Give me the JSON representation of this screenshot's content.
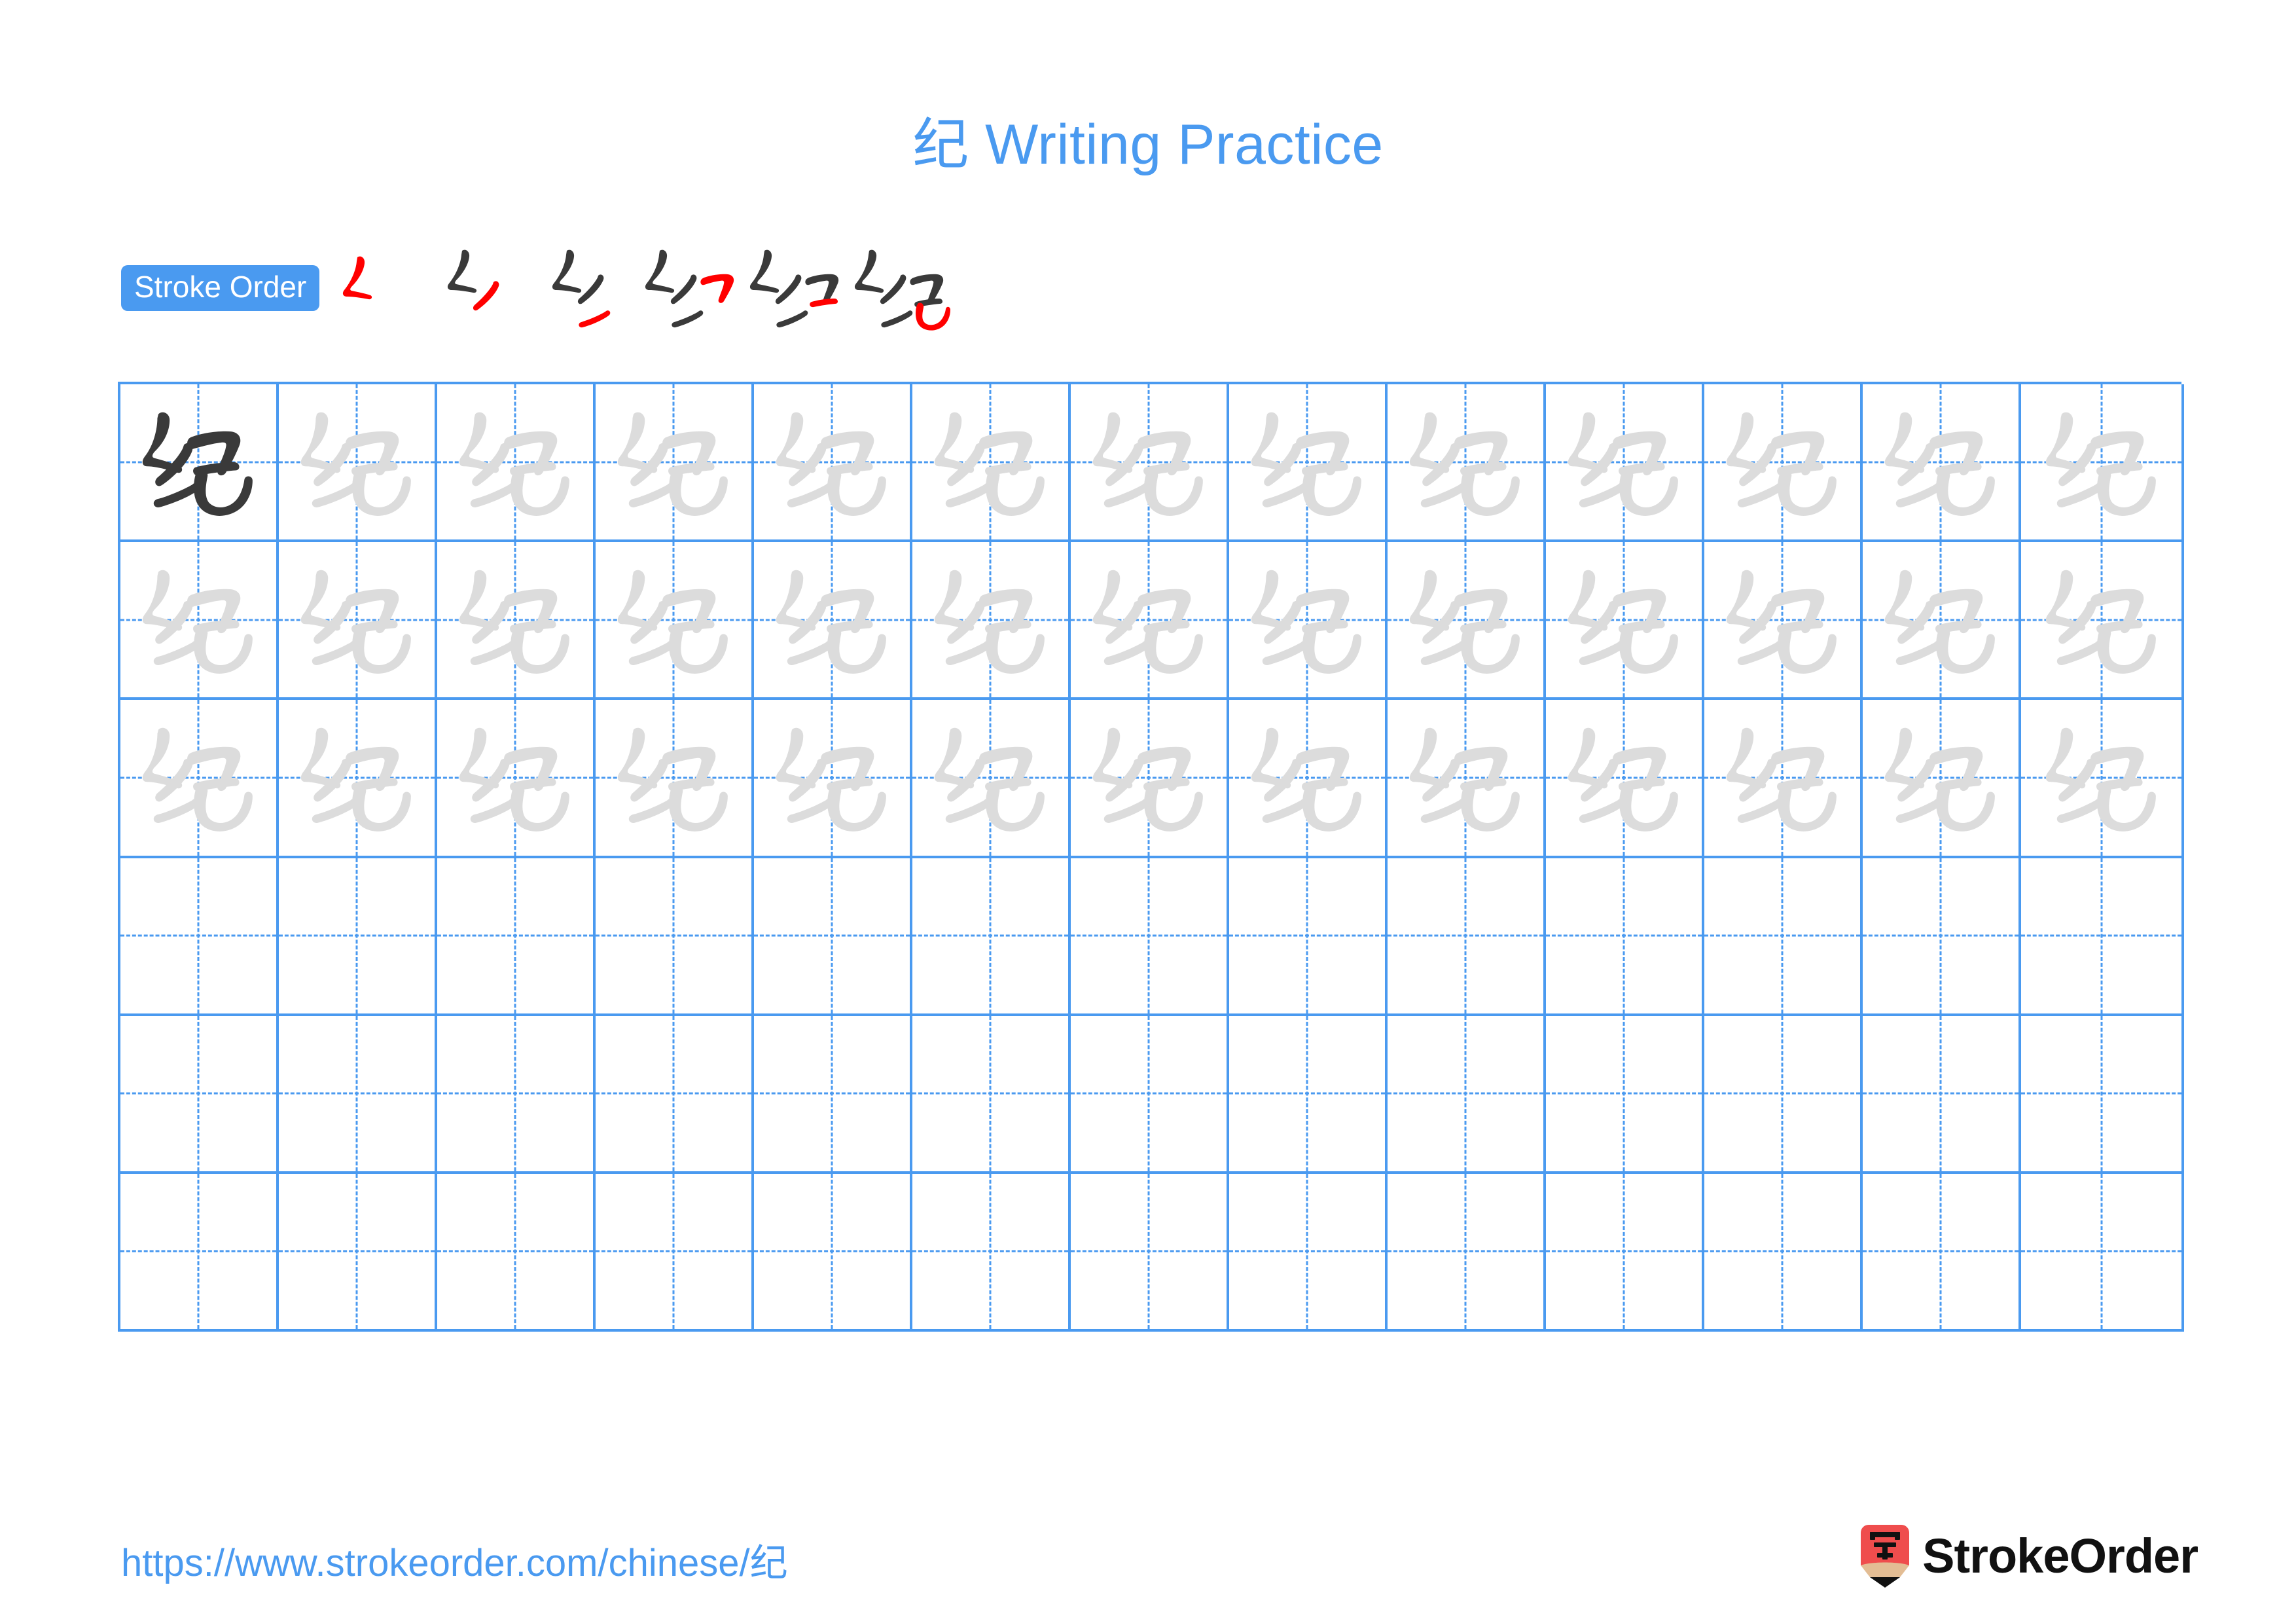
{
  "character": "纪",
  "page_title": "纪 Writing Practice",
  "title_prefix_char": "纪",
  "title_suffix": " Writing Practice",
  "colors": {
    "accent_blue": "#4a9af0",
    "grid_line_blue": "#4a9af0",
    "new_stroke_red": "#ff0000",
    "prior_stroke_dark": "#3a3a3a",
    "ghost_char_gray": "#dcdcdc",
    "logo_red": "#ef4d4d",
    "logo_wood": "#e3bd94",
    "logo_text_black": "#111111"
  },
  "stroke_order": {
    "badge_label": "Stroke Order",
    "total_strokes": 6,
    "steps": [
      {
        "index": 1,
        "label": "stroke-1",
        "strokes_shown": 1
      },
      {
        "index": 2,
        "label": "stroke-2",
        "strokes_shown": 2
      },
      {
        "index": 3,
        "label": "stroke-3",
        "strokes_shown": 3
      },
      {
        "index": 4,
        "label": "stroke-4",
        "strokes_shown": 4
      },
      {
        "index": 5,
        "label": "stroke-5",
        "strokes_shown": 5
      },
      {
        "index": 6,
        "label": "stroke-6",
        "strokes_shown": 6
      }
    ]
  },
  "grid": {
    "columns": 13,
    "rows": 6,
    "rows_with_characters": 3,
    "empty_rows": 3,
    "traced_cell_row": 1,
    "traced_cell_column": 1,
    "cell_character": "纪"
  },
  "footer": {
    "url": "https://www.strokeorder.com/chinese/纪",
    "brand_name": "StrokeOrder",
    "logo_glyph": "字"
  }
}
